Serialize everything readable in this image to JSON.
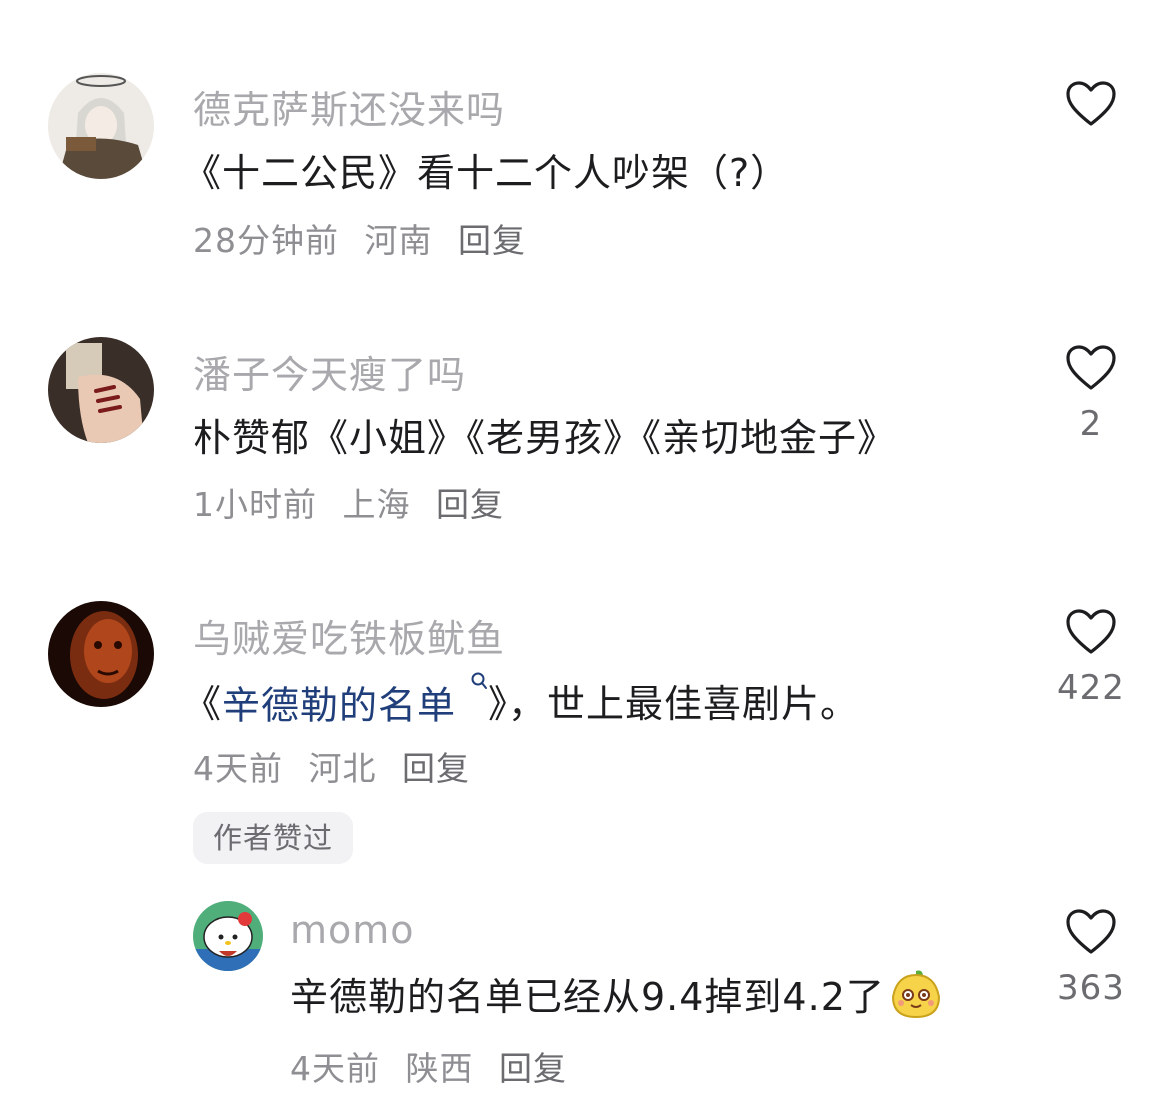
{
  "comments": [
    {
      "username": "德克萨斯还没来吗",
      "text": "《十二公民》看十二个人吵架（?）",
      "time": "28分钟前",
      "location": "河南",
      "reply_label": "回复",
      "likes": ""
    },
    {
      "username": "潘子今天瘦了吗",
      "text": "朴赞郁《小姐》《老男孩》《亲切地金子》",
      "time": "1小时前",
      "location": "上海",
      "reply_label": "回复",
      "likes": "2"
    },
    {
      "username": "乌贼爱吃铁板鱿鱼",
      "text_prefix": "《",
      "text_link": "辛德勒的名单",
      "text_suffix": "》，世上最佳喜剧片。",
      "time": "4天前",
      "location": "河北",
      "reply_label": "回复",
      "likes": "422",
      "badge": "作者赞过"
    }
  ],
  "reply": {
    "username": "momo",
    "text": "辛德勒的名单已经从9.4掉到4.2了",
    "time": "4天前",
    "location": "陕西",
    "reply_label": "回复",
    "likes": "363"
  },
  "icons": {
    "like": "heart-outline-icon",
    "search": "search-icon",
    "emoji": "smiling-fruit-emoji"
  },
  "colors": {
    "link": "#1f3e7a",
    "username": "#a9a9ad",
    "text": "#1d1d1f"
  }
}
